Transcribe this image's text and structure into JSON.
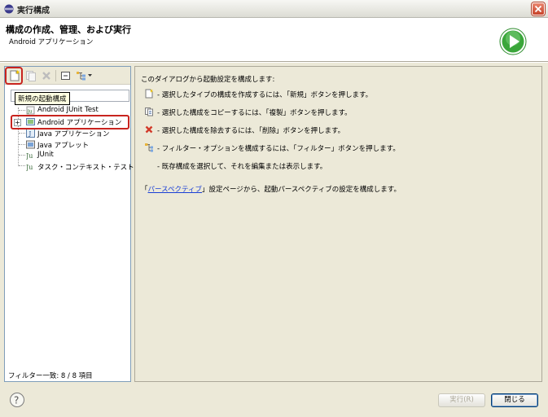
{
  "window": {
    "title": "実行構成"
  },
  "header": {
    "title": "構成の作成、管理、および実行",
    "subtitle": "Android アプリケーション"
  },
  "left": {
    "tooltip": "新規の起動構成",
    "tree": [
      {
        "label": "Android JUnit Test",
        "icon": "android-junit-icon"
      },
      {
        "label": "Android アプリケーション",
        "icon": "android-app-icon"
      },
      {
        "label": "Java アプリケーション",
        "icon": "java-app-icon"
      },
      {
        "label": "Java アプレット",
        "icon": "java-applet-icon"
      },
      {
        "label": "JUnit",
        "icon": "junit-icon"
      },
      {
        "label": "タスク・コンテキスト・テスト",
        "icon": "task-context-icon"
      }
    ],
    "status": "フィルター一致: 8 / 8 項目"
  },
  "right": {
    "intro": "このダイアログから起動設定を構成します:",
    "items": [
      {
        "icon": "new-icon",
        "text": "- 選択したタイプの構成を作成するには、「新規」ボタンを押します。"
      },
      {
        "icon": "copy-icon",
        "text": "- 選択した構成をコピーするには、「複製」ボタンを押します。"
      },
      {
        "icon": "delete-icon",
        "text": "- 選択した構成を除去するには、「削除」ボタンを押します。"
      },
      {
        "icon": "filter-icon",
        "text": "- フィルター・オプションを構成するには、「フィルター」ボタンを押します。"
      },
      {
        "icon": "",
        "text": "- 既存構成を選択して、それを編集または表示します。"
      }
    ],
    "persp_prefix": "「",
    "persp_link": "パースペクティブ",
    "persp_suffix": "」設定ページから、起動パースペクティブの設定を構成します。"
  },
  "buttons": {
    "run": "実行(R)",
    "close": "閉じる"
  },
  "colors": {
    "highlight": "#c8241f",
    "link": "#1a3fd6",
    "run_green": "#3aa63a"
  }
}
